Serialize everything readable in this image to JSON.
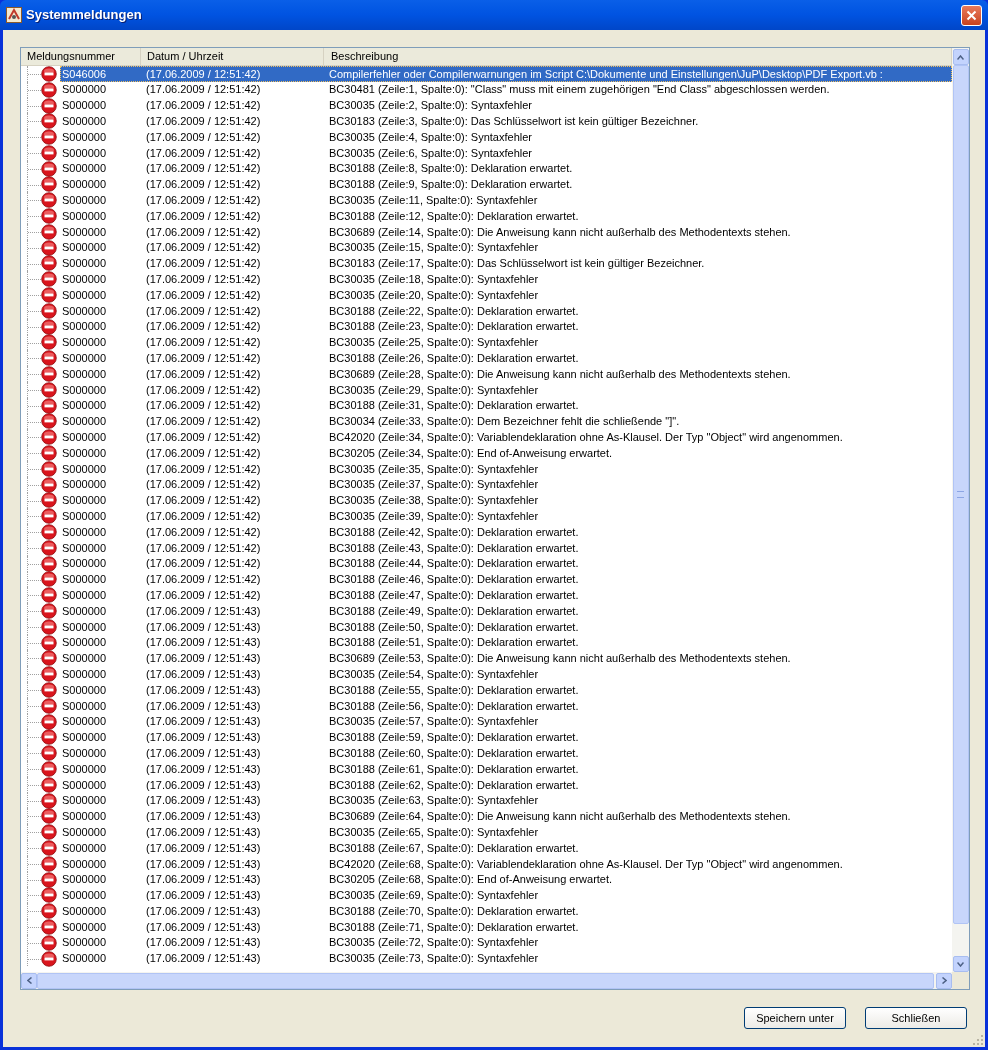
{
  "window": {
    "title": "Systemmeldungen"
  },
  "table": {
    "columns": [
      "Meldungsnummer",
      "Datum / Uhrzeit",
      "Beschreibung"
    ],
    "rows": [
      {
        "number": "S046006",
        "time": "(17.06.2009 / 12:51:42)",
        "description": "Compilerfehler oder Compilerwarnungen im Script C:\\Dokumente und Einstellungen\\JuP\\Desktop\\PDF Export.vb :",
        "selected": true
      },
      {
        "number": "S000000",
        "time": "(17.06.2009 / 12:51:42)",
        "description": "BC30481 (Zeile:1, Spalte:0): \"Class\" muss mit einem zugehörigen \"End Class\" abgeschlossen werden.",
        "selected": false
      },
      {
        "number": "S000000",
        "time": "(17.06.2009 / 12:51:42)",
        "description": "BC30035 (Zeile:2, Spalte:0): Syntaxfehler",
        "selected": false
      },
      {
        "number": "S000000",
        "time": "(17.06.2009 / 12:51:42)",
        "description": "BC30183 (Zeile:3, Spalte:0): Das Schlüsselwort ist kein gültiger Bezeichner.",
        "selected": false
      },
      {
        "number": "S000000",
        "time": "(17.06.2009 / 12:51:42)",
        "description": "BC30035 (Zeile:4, Spalte:0): Syntaxfehler",
        "selected": false
      },
      {
        "number": "S000000",
        "time": "(17.06.2009 / 12:51:42)",
        "description": "BC30035 (Zeile:6, Spalte:0): Syntaxfehler",
        "selected": false
      },
      {
        "number": "S000000",
        "time": "(17.06.2009 / 12:51:42)",
        "description": "BC30188 (Zeile:8, Spalte:0): Deklaration erwartet.",
        "selected": false
      },
      {
        "number": "S000000",
        "time": "(17.06.2009 / 12:51:42)",
        "description": "BC30188 (Zeile:9, Spalte:0): Deklaration erwartet.",
        "selected": false
      },
      {
        "number": "S000000",
        "time": "(17.06.2009 / 12:51:42)",
        "description": "BC30035 (Zeile:11, Spalte:0): Syntaxfehler",
        "selected": false
      },
      {
        "number": "S000000",
        "time": "(17.06.2009 / 12:51:42)",
        "description": "BC30188 (Zeile:12, Spalte:0): Deklaration erwartet.",
        "selected": false
      },
      {
        "number": "S000000",
        "time": "(17.06.2009 / 12:51:42)",
        "description": "BC30689 (Zeile:14, Spalte:0): Die Anweisung kann nicht außerhalb des Methodentexts stehen.",
        "selected": false
      },
      {
        "number": "S000000",
        "time": "(17.06.2009 / 12:51:42)",
        "description": "BC30035 (Zeile:15, Spalte:0): Syntaxfehler",
        "selected": false
      },
      {
        "number": "S000000",
        "time": "(17.06.2009 / 12:51:42)",
        "description": "BC30183 (Zeile:17, Spalte:0): Das Schlüsselwort ist kein gültiger Bezeichner.",
        "selected": false
      },
      {
        "number": "S000000",
        "time": "(17.06.2009 / 12:51:42)",
        "description": "BC30035 (Zeile:18, Spalte:0): Syntaxfehler",
        "selected": false
      },
      {
        "number": "S000000",
        "time": "(17.06.2009 / 12:51:42)",
        "description": "BC30035 (Zeile:20, Spalte:0): Syntaxfehler",
        "selected": false
      },
      {
        "number": "S000000",
        "time": "(17.06.2009 / 12:51:42)",
        "description": "BC30188 (Zeile:22, Spalte:0): Deklaration erwartet.",
        "selected": false
      },
      {
        "number": "S000000",
        "time": "(17.06.2009 / 12:51:42)",
        "description": "BC30188 (Zeile:23, Spalte:0): Deklaration erwartet.",
        "selected": false
      },
      {
        "number": "S000000",
        "time": "(17.06.2009 / 12:51:42)",
        "description": "BC30035 (Zeile:25, Spalte:0): Syntaxfehler",
        "selected": false
      },
      {
        "number": "S000000",
        "time": "(17.06.2009 / 12:51:42)",
        "description": "BC30188 (Zeile:26, Spalte:0): Deklaration erwartet.",
        "selected": false
      },
      {
        "number": "S000000",
        "time": "(17.06.2009 / 12:51:42)",
        "description": "BC30689 (Zeile:28, Spalte:0): Die Anweisung kann nicht außerhalb des Methodentexts stehen.",
        "selected": false
      },
      {
        "number": "S000000",
        "time": "(17.06.2009 / 12:51:42)",
        "description": "BC30035 (Zeile:29, Spalte:0): Syntaxfehler",
        "selected": false
      },
      {
        "number": "S000000",
        "time": "(17.06.2009 / 12:51:42)",
        "description": "BC30188 (Zeile:31, Spalte:0): Deklaration erwartet.",
        "selected": false
      },
      {
        "number": "S000000",
        "time": "(17.06.2009 / 12:51:42)",
        "description": "BC30034 (Zeile:33, Spalte:0): Dem Bezeichner fehlt die schließende \"]\".",
        "selected": false
      },
      {
        "number": "S000000",
        "time": "(17.06.2009 / 12:51:42)",
        "description": "BC42020 (Zeile:34, Spalte:0): Variablendeklaration ohne As-Klausel. Der Typ \"Object\" wird angenommen.",
        "selected": false
      },
      {
        "number": "S000000",
        "time": "(17.06.2009 / 12:51:42)",
        "description": "BC30205 (Zeile:34, Spalte:0): End of-Anweisung erwartet.",
        "selected": false
      },
      {
        "number": "S000000",
        "time": "(17.06.2009 / 12:51:42)",
        "description": "BC30035 (Zeile:35, Spalte:0): Syntaxfehler",
        "selected": false
      },
      {
        "number": "S000000",
        "time": "(17.06.2009 / 12:51:42)",
        "description": "BC30035 (Zeile:37, Spalte:0): Syntaxfehler",
        "selected": false
      },
      {
        "number": "S000000",
        "time": "(17.06.2009 / 12:51:42)",
        "description": "BC30035 (Zeile:38, Spalte:0): Syntaxfehler",
        "selected": false
      },
      {
        "number": "S000000",
        "time": "(17.06.2009 / 12:51:42)",
        "description": "BC30035 (Zeile:39, Spalte:0): Syntaxfehler",
        "selected": false
      },
      {
        "number": "S000000",
        "time": "(17.06.2009 / 12:51:42)",
        "description": "BC30188 (Zeile:42, Spalte:0): Deklaration erwartet.",
        "selected": false
      },
      {
        "number": "S000000",
        "time": "(17.06.2009 / 12:51:42)",
        "description": "BC30188 (Zeile:43, Spalte:0): Deklaration erwartet.",
        "selected": false
      },
      {
        "number": "S000000",
        "time": "(17.06.2009 / 12:51:42)",
        "description": "BC30188 (Zeile:44, Spalte:0): Deklaration erwartet.",
        "selected": false
      },
      {
        "number": "S000000",
        "time": "(17.06.2009 / 12:51:42)",
        "description": "BC30188 (Zeile:46, Spalte:0): Deklaration erwartet.",
        "selected": false
      },
      {
        "number": "S000000",
        "time": "(17.06.2009 / 12:51:42)",
        "description": "BC30188 (Zeile:47, Spalte:0): Deklaration erwartet.",
        "selected": false
      },
      {
        "number": "S000000",
        "time": "(17.06.2009 / 12:51:43)",
        "description": "BC30188 (Zeile:49, Spalte:0): Deklaration erwartet.",
        "selected": false
      },
      {
        "number": "S000000",
        "time": "(17.06.2009 / 12:51:43)",
        "description": "BC30188 (Zeile:50, Spalte:0): Deklaration erwartet.",
        "selected": false
      },
      {
        "number": "S000000",
        "time": "(17.06.2009 / 12:51:43)",
        "description": "BC30188 (Zeile:51, Spalte:0): Deklaration erwartet.",
        "selected": false
      },
      {
        "number": "S000000",
        "time": "(17.06.2009 / 12:51:43)",
        "description": "BC30689 (Zeile:53, Spalte:0): Die Anweisung kann nicht außerhalb des Methodentexts stehen.",
        "selected": false
      },
      {
        "number": "S000000",
        "time": "(17.06.2009 / 12:51:43)",
        "description": "BC30035 (Zeile:54, Spalte:0): Syntaxfehler",
        "selected": false
      },
      {
        "number": "S000000",
        "time": "(17.06.2009 / 12:51:43)",
        "description": "BC30188 (Zeile:55, Spalte:0): Deklaration erwartet.",
        "selected": false
      },
      {
        "number": "S000000",
        "time": "(17.06.2009 / 12:51:43)",
        "description": "BC30188 (Zeile:56, Spalte:0): Deklaration erwartet.",
        "selected": false
      },
      {
        "number": "S000000",
        "time": "(17.06.2009 / 12:51:43)",
        "description": "BC30035 (Zeile:57, Spalte:0): Syntaxfehler",
        "selected": false
      },
      {
        "number": "S000000",
        "time": "(17.06.2009 / 12:51:43)",
        "description": "BC30188 (Zeile:59, Spalte:0): Deklaration erwartet.",
        "selected": false
      },
      {
        "number": "S000000",
        "time": "(17.06.2009 / 12:51:43)",
        "description": "BC30188 (Zeile:60, Spalte:0): Deklaration erwartet.",
        "selected": false
      },
      {
        "number": "S000000",
        "time": "(17.06.2009 / 12:51:43)",
        "description": "BC30188 (Zeile:61, Spalte:0): Deklaration erwartet.",
        "selected": false
      },
      {
        "number": "S000000",
        "time": "(17.06.2009 / 12:51:43)",
        "description": "BC30188 (Zeile:62, Spalte:0): Deklaration erwartet.",
        "selected": false
      },
      {
        "number": "S000000",
        "time": "(17.06.2009 / 12:51:43)",
        "description": "BC30035 (Zeile:63, Spalte:0): Syntaxfehler",
        "selected": false
      },
      {
        "number": "S000000",
        "time": "(17.06.2009 / 12:51:43)",
        "description": "BC30689 (Zeile:64, Spalte:0): Die Anweisung kann nicht außerhalb des Methodentexts stehen.",
        "selected": false
      },
      {
        "number": "S000000",
        "time": "(17.06.2009 / 12:51:43)",
        "description": "BC30035 (Zeile:65, Spalte:0): Syntaxfehler",
        "selected": false
      },
      {
        "number": "S000000",
        "time": "(17.06.2009 / 12:51:43)",
        "description": "BC30188 (Zeile:67, Spalte:0): Deklaration erwartet.",
        "selected": false
      },
      {
        "number": "S000000",
        "time": "(17.06.2009 / 12:51:43)",
        "description": "BC42020 (Zeile:68, Spalte:0): Variablendeklaration ohne As-Klausel. Der Typ \"Object\" wird angenommen.",
        "selected": false
      },
      {
        "number": "S000000",
        "time": "(17.06.2009 / 12:51:43)",
        "description": "BC30205 (Zeile:68, Spalte:0): End of-Anweisung erwartet.",
        "selected": false
      },
      {
        "number": "S000000",
        "time": "(17.06.2009 / 12:51:43)",
        "description": "BC30035 (Zeile:69, Spalte:0): Syntaxfehler",
        "selected": false
      },
      {
        "number": "S000000",
        "time": "(17.06.2009 / 12:51:43)",
        "description": "BC30188 (Zeile:70, Spalte:0): Deklaration erwartet.",
        "selected": false
      },
      {
        "number": "S000000",
        "time": "(17.06.2009 / 12:51:43)",
        "description": "BC30188 (Zeile:71, Spalte:0): Deklaration erwartet.",
        "selected": false
      },
      {
        "number": "S000000",
        "time": "(17.06.2009 / 12:51:43)",
        "description": "BC30035 (Zeile:72, Spalte:0): Syntaxfehler",
        "selected": false
      },
      {
        "number": "S000000",
        "time": "(17.06.2009 / 12:51:43)",
        "description": "BC30035 (Zeile:73, Spalte:0): Syntaxfehler",
        "selected": false
      }
    ]
  },
  "buttons": [
    "Speichern unter",
    "Schließen"
  ]
}
